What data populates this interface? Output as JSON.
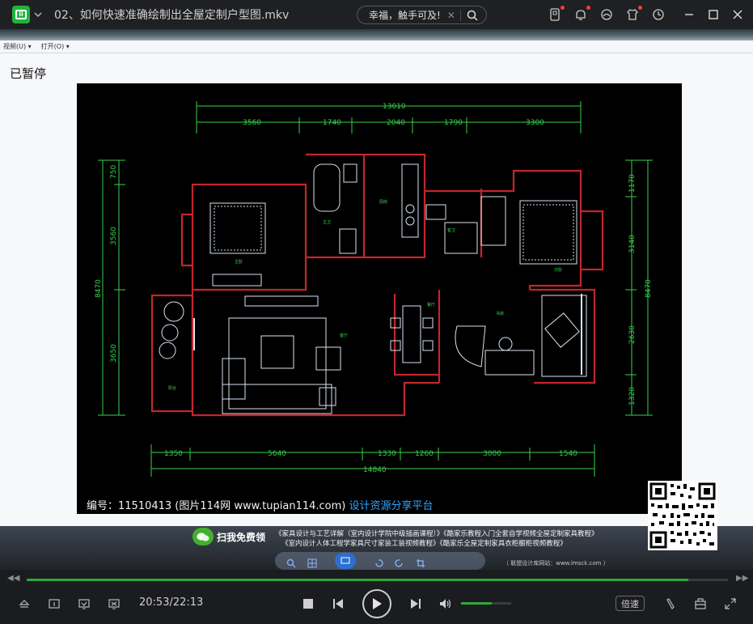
{
  "window": {
    "title": "02、如何快速准确绘制出全屋定制户型图.mkv",
    "search_text": "幸福，触手可及!",
    "search_clear": "✕"
  },
  "video": {
    "paused_label": "已暂停",
    "menubar": [
      "视频(U) ▾",
      "打开(O) ▾"
    ],
    "plan": {
      "top_total": "13010",
      "top_dims": [
        "3560",
        "1740",
        "2040",
        "1790",
        "3300"
      ],
      "bottom_total": "14840",
      "bottom_dims": [
        "1350",
        "5640",
        "1330",
        "1260",
        "3000",
        "1540"
      ],
      "left_dims": [
        "750",
        "3560",
        "8470",
        "3650"
      ],
      "right_dims": [
        "1170",
        "3140",
        "8470",
        "2630",
        "1320"
      ],
      "caption_number": "编号：11510413 (图片114网 www.tupian114.com)",
      "caption_link": "设计资源分享平台"
    },
    "ad": {
      "scan_label": "扫我免费领",
      "line1": "《家具设计与工艺详解（室内设计学院中级插画课程）》《酷家乐教程入门全套自学视频全屋定制家具教程》",
      "line2": "《室内设计人体工程学家具尺寸家装工装视频教程》《酷家乐全屋定制家具衣柜橱柜视频教程》",
      "site": "（ 联盟设计库网站：www.lmsck.com ）"
    }
  },
  "player": {
    "current_time": "20:53/22:13",
    "progress": 0.944,
    "volume": 0.62,
    "speed_label": "倍速"
  },
  "colors": {
    "accent": "#2ea83b",
    "logo": "#1fb43c",
    "cad_wall": "#c2262b",
    "cad_dim": "#37d24a",
    "cad_furniture": "#d9e2f0",
    "caption_link": "#2fa3ff"
  },
  "icons": [
    "logo-icon",
    "chevron-down-icon",
    "search-icon",
    "phone-icon",
    "bell-icon",
    "skin-icon",
    "shirt-icon",
    "history-icon",
    "minimize-icon",
    "maximize-icon",
    "close-icon",
    "eject-icon",
    "subtitle-icon",
    "screenshot-icon",
    "screenshot2-icon",
    "stop-icon",
    "previous-icon",
    "play-icon",
    "next-icon",
    "volume-icon",
    "pen-icon",
    "box-icon",
    "fullscreen-icon"
  ]
}
